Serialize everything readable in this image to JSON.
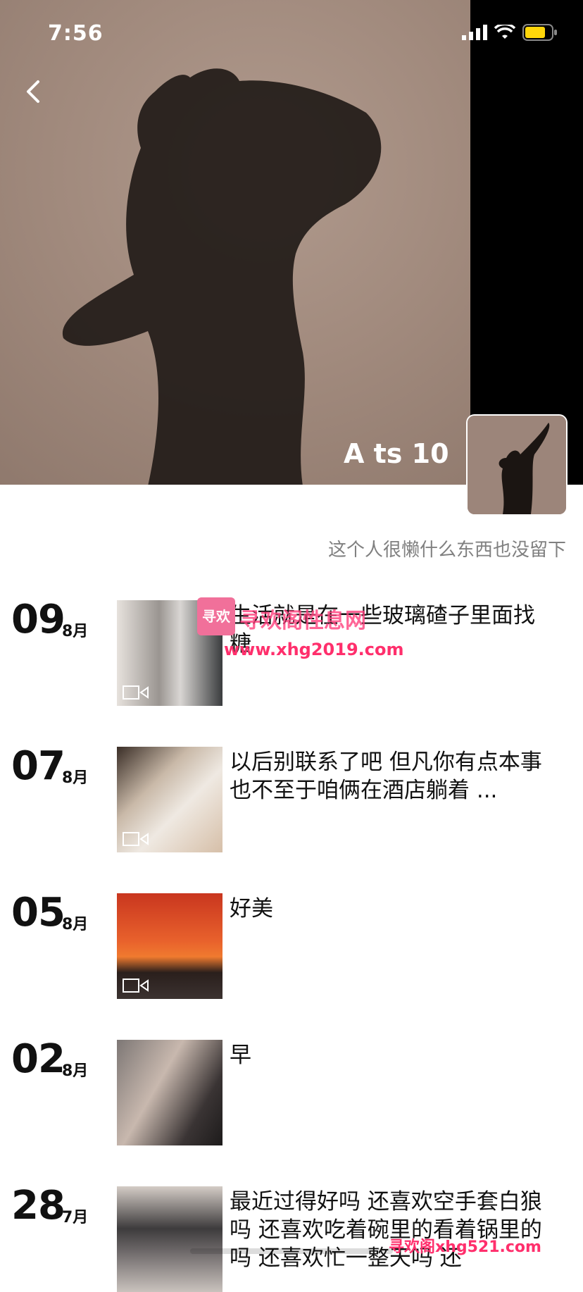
{
  "status": {
    "time": "7:56"
  },
  "profile": {
    "username": "A ts 10",
    "bio": "这个人很懒什么东西也没留下"
  },
  "posts": [
    {
      "day": "09",
      "month": "8月",
      "text": "生活就是在一些玻璃碴子里面找糖",
      "video": true,
      "thumb_color": "#c9c4bf"
    },
    {
      "day": "07",
      "month": "8月",
      "text": "以后别联系了吧 但凡你有点本事也不至于咱俩在酒店躺着 ...",
      "video": true,
      "thumb_color": "#d9cfc6"
    },
    {
      "day": "05",
      "month": "8月",
      "text": "好美",
      "video": true,
      "thumb_color": "#d9552a"
    },
    {
      "day": "02",
      "month": "8月",
      "text": "早",
      "video": false,
      "thumb_color": "#5a5555"
    },
    {
      "day": "28",
      "month": "7月",
      "text": "最近过得好吗 还喜欢空手套白狼吗 还喜欢吃着碗里的看着锅里的吗 还喜欢忙一整天吗 还",
      "video": false,
      "thumb_color": "#b9b2ad"
    }
  ],
  "watermarks": {
    "logo_text": "寻欢",
    "site_name": "寻欢阁性息网",
    "site_url": "www.xhg2019.com",
    "bottom": "寻欢阁xhg521.com"
  },
  "colors": {
    "accent": "#ff2f6c",
    "battery": "#ffd60a"
  }
}
